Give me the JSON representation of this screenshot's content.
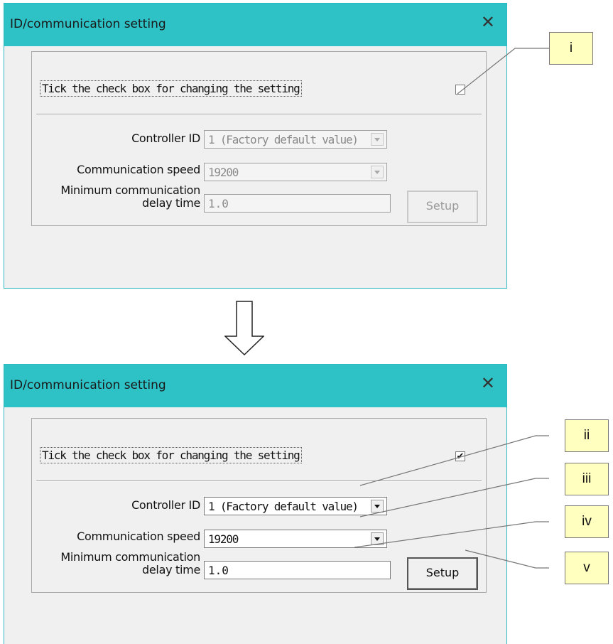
{
  "before": {
    "title": "ID/communication setting",
    "close_glyph": "✕",
    "checkbox_label": "Tick the check box for changing the setting",
    "checked": false,
    "check_glyph": "",
    "controller_id": {
      "label": "Controller ID",
      "value": "1 (Factory default value)"
    },
    "comm_speed": {
      "label": "Communication speed",
      "value": "19200"
    },
    "delay": {
      "label_line1": "Minimum communication",
      "label_line2": "delay time",
      "value": "1.0"
    },
    "setup_label": "Setup",
    "enabled": false
  },
  "after": {
    "title": "ID/communication setting",
    "close_glyph": "✕",
    "checkbox_label": "Tick the check box for changing the setting",
    "checked": true,
    "check_glyph": "✔",
    "controller_id": {
      "label": "Controller ID",
      "value": "1 (Factory default value)"
    },
    "comm_speed": {
      "label": "Communication speed",
      "value": "19200"
    },
    "delay": {
      "label_line1": "Minimum communication",
      "label_line2": "delay time",
      "value": "1.0"
    },
    "setup_label": "Setup",
    "enabled": true
  },
  "callouts": [
    "i",
    "ii",
    "iii",
    "iv",
    "v"
  ],
  "colors": {
    "titlebar": "#2ec2c6",
    "window_bg": "#f0f0f0",
    "callout_bg": "#ffffc0",
    "border": "#2bb9c2"
  },
  "icons": {
    "close": "close-icon",
    "transition_arrow": "down-arrow-icon",
    "dropdown": "chevron-down-icon"
  }
}
